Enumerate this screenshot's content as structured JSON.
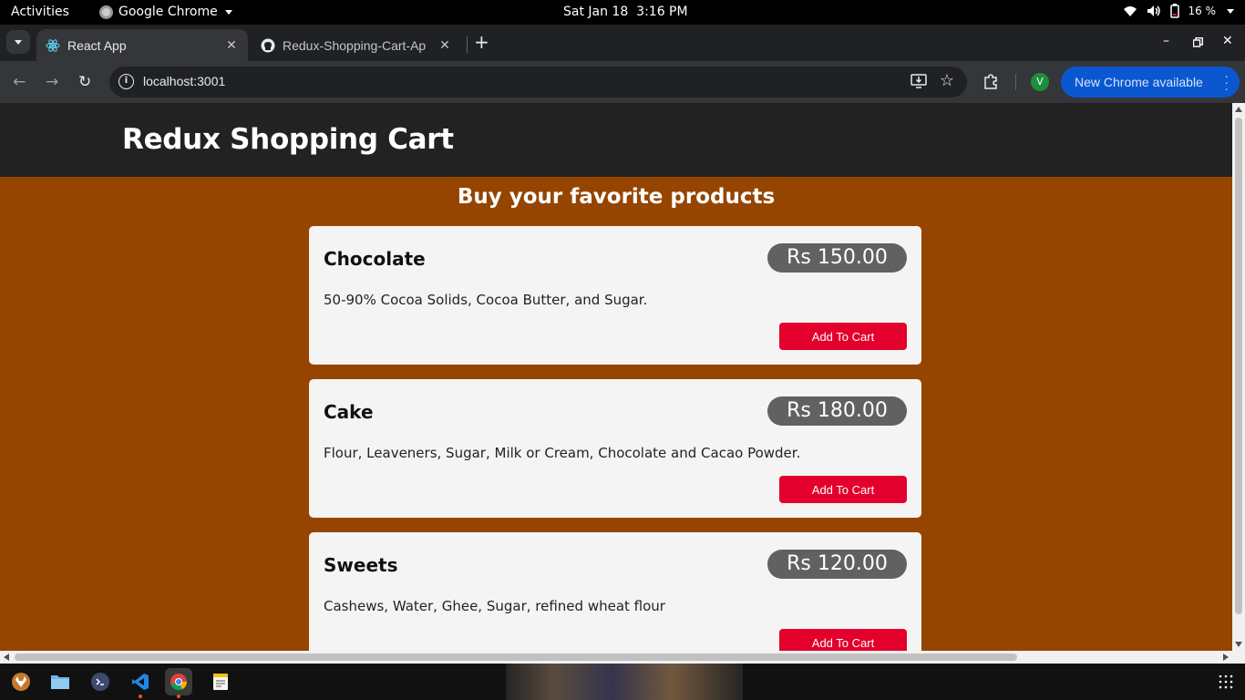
{
  "system_bar": {
    "activities": "Activities",
    "app_name": "Google Chrome",
    "date": "Sat Jan 18",
    "time": "3:16 PM",
    "battery": "16 %"
  },
  "browser": {
    "tabs": [
      {
        "title": "React App",
        "active": true
      },
      {
        "title": "Redux-Shopping-Cart-Ap",
        "active": false
      }
    ],
    "url": "localhost:3001",
    "profile_initial": "V",
    "update_button": "New Chrome available"
  },
  "page": {
    "header_title": "Redux Shopping Cart",
    "subtitle": "Buy your favorite products",
    "products": [
      {
        "name": "Chocolate",
        "price": "Rs 150.00",
        "description": "50-90% Cocoa Solids, Cocoa Butter, and Sugar.",
        "button": "Add To Cart"
      },
      {
        "name": "Cake",
        "price": "Rs 180.00",
        "description": "Flour, Leaveners, Sugar, Milk or Cream, Chocolate and Cacao Powder.",
        "button": "Add To Cart"
      },
      {
        "name": "Sweets",
        "price": "Rs 120.00",
        "description": "Cashews, Water, Ghee, Sugar, refined wheat flour",
        "button": "Add To Cart"
      }
    ]
  },
  "colors": {
    "page_background": "#964500",
    "header_background": "#222222",
    "card_background": "#f4f4f4",
    "price_badge": "#616161",
    "add_button": "#e3002d",
    "update_pill": "#0b57d0"
  },
  "dock": {
    "items": [
      "gitlab-icon",
      "files-icon",
      "terminal-icon",
      "vscode-icon",
      "chrome-icon",
      "text-editor-icon"
    ]
  }
}
